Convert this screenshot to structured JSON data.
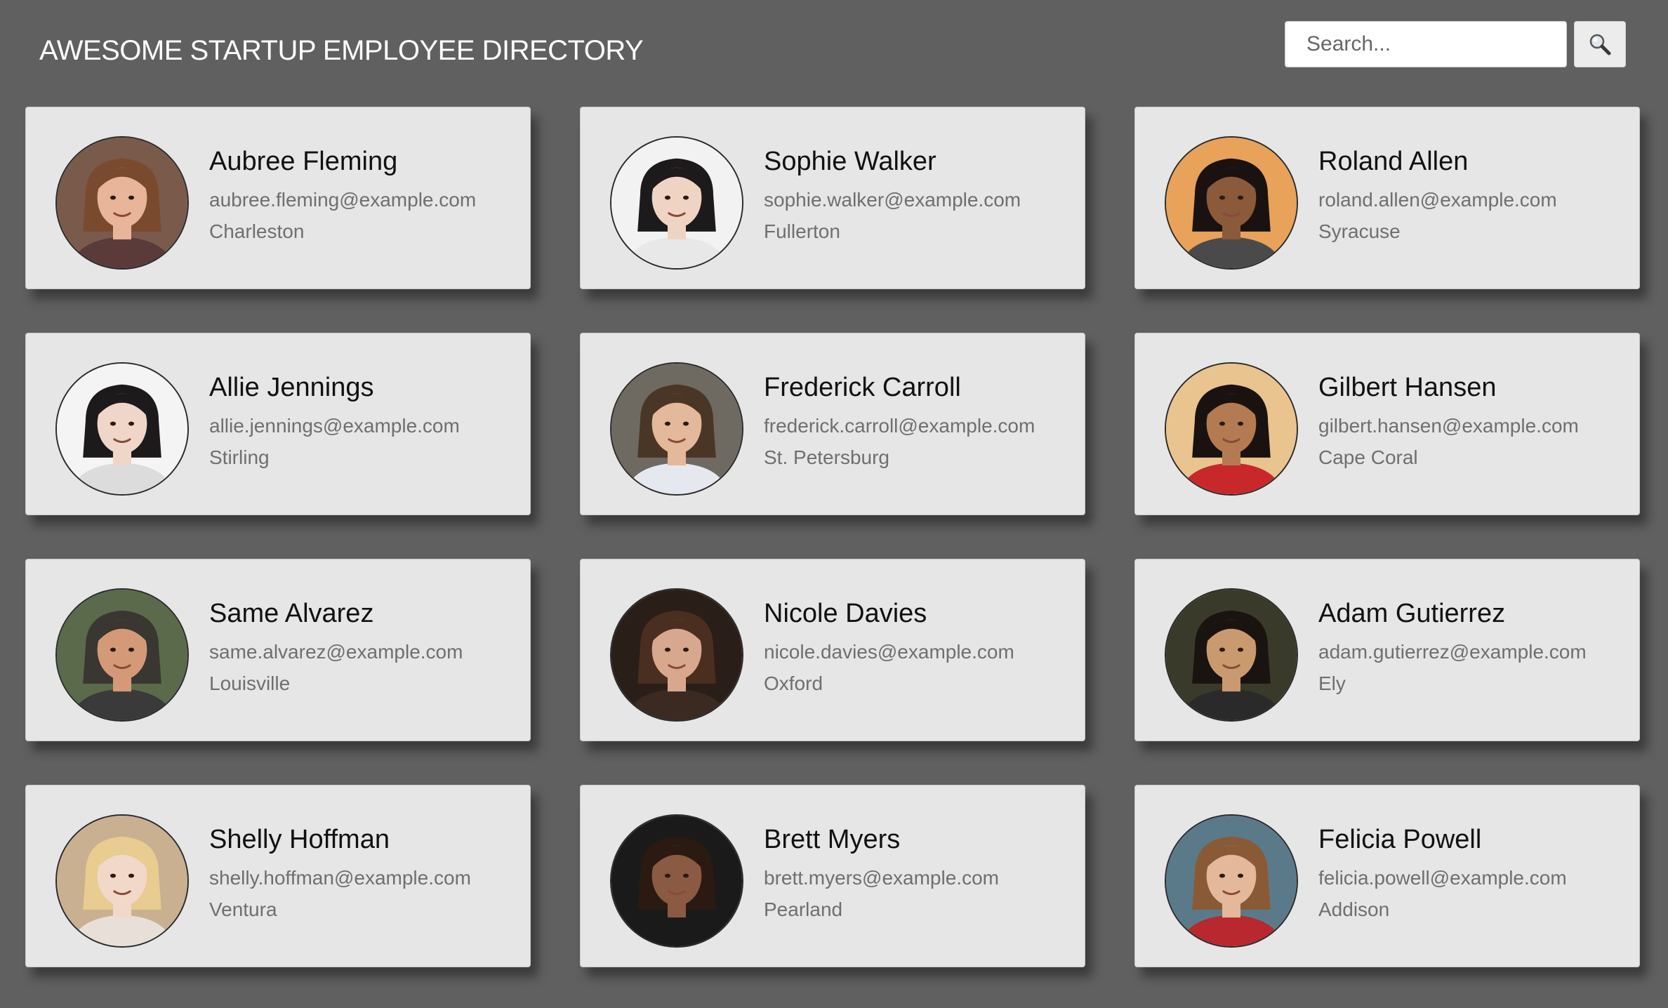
{
  "header": {
    "title": "AWESOME STARTUP EMPLOYEE DIRECTORY",
    "search_placeholder": "Search...",
    "search_icon": "magnifier-icon"
  },
  "employees": [
    {
      "name": "Aubree Fleming",
      "email": "aubree.fleming@example.com",
      "city": "Charleston",
      "avatar": {
        "bg": "#7a5a4a",
        "skin": "#e8b49a",
        "hair": "#7a4a2e",
        "shirt": "#5b3a3a"
      }
    },
    {
      "name": "Sophie Walker",
      "email": "sophie.walker@example.com",
      "city": "Fullerton",
      "avatar": {
        "bg": "#f2f2f2",
        "skin": "#efd4c4",
        "hair": "#1c1a1a",
        "shirt": "#e8e8e8"
      }
    },
    {
      "name": "Roland Allen",
      "email": "roland.allen@example.com",
      "city": "Syracuse",
      "avatar": {
        "bg": "#e8a25a",
        "skin": "#8a5a3a",
        "hair": "#1a1210",
        "shirt": "#4a4a4a"
      }
    },
    {
      "name": "Allie Jennings",
      "email": "allie.jennings@example.com",
      "city": "Stirling",
      "avatar": {
        "bg": "#f4f4f4",
        "skin": "#f0d6c8",
        "hair": "#1c1a1a",
        "shirt": "#dcdcdc"
      }
    },
    {
      "name": "Frederick Carroll",
      "email": "frederick.carroll@example.com",
      "city": "St. Petersburg",
      "avatar": {
        "bg": "#6e6a62",
        "skin": "#e4b89a",
        "hair": "#4a3626",
        "shirt": "#e6e8f0"
      }
    },
    {
      "name": "Gilbert Hansen",
      "email": "gilbert.hansen@example.com",
      "city": "Cape Coral",
      "avatar": {
        "bg": "#e9c48e",
        "skin": "#b47a52",
        "hair": "#1a1210",
        "shirt": "#c8282a"
      }
    },
    {
      "name": "Same Alvarez",
      "email": "same.alvarez@example.com",
      "city": "Louisville",
      "avatar": {
        "bg": "#5a6a4a",
        "skin": "#d49a78",
        "hair": "#3a3632",
        "shirt": "#3a3a3a"
      }
    },
    {
      "name": "Nicole Davies",
      "email": "nicole.davies@example.com",
      "city": "Oxford",
      "avatar": {
        "bg": "#2a1e18",
        "skin": "#d8a88e",
        "hair": "#4a2e20",
        "shirt": "#3a2a22"
      }
    },
    {
      "name": "Adam Gutierrez",
      "email": "adam.gutierrez@example.com",
      "city": "Ely",
      "avatar": {
        "bg": "#3a3a2a",
        "skin": "#c89a6e",
        "hair": "#1a1410",
        "shirt": "#2a2a2a"
      }
    },
    {
      "name": "Shelly Hoffman",
      "email": "shelly.hoffman@example.com",
      "city": "Ventura",
      "avatar": {
        "bg": "#c8b090",
        "skin": "#f2d8c8",
        "hair": "#e8cc90",
        "shirt": "#e8e0d8"
      }
    },
    {
      "name": "Brett Myers",
      "email": "brett.myers@example.com",
      "city": "Pearland",
      "avatar": {
        "bg": "#1a1a1a",
        "skin": "#8a5a42",
        "hair": "#2a1a12",
        "shirt": "#1a1a1a"
      }
    },
    {
      "name": "Felicia Powell",
      "email": "felicia.powell@example.com",
      "city": "Addison",
      "avatar": {
        "bg": "#5a7a8a",
        "skin": "#e4b89a",
        "hair": "#8a5a36",
        "shirt": "#b8282e"
      }
    }
  ]
}
